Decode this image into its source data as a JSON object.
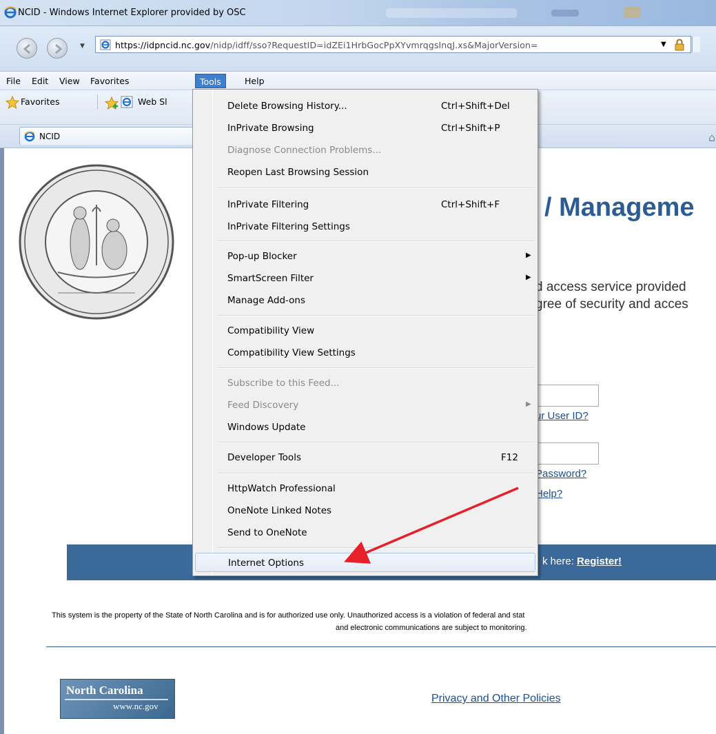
{
  "window": {
    "title": "NCID - Windows Internet Explorer provided by OSC",
    "url_host": "https://idpncid.nc.gov",
    "url_path": "/nidp/idff/sso?RequestID=idZEi1HrbGocPpXYvmrqgsInqJ.xs&MajorVersion="
  },
  "menubar": {
    "file": "File",
    "edit": "Edit",
    "view": "View",
    "favorites": "Favorites",
    "tools": "Tools",
    "help": "Help"
  },
  "favbar": {
    "favorites_label": "Favorites",
    "web_slice_label": "Web Sl"
  },
  "tab": {
    "label": "NCID"
  },
  "tools_menu": {
    "items": [
      {
        "label": "Delete Browsing History...",
        "shortcut": "Ctrl+Shift+Del"
      },
      {
        "label": "InPrivate Browsing",
        "shortcut": "Ctrl+Shift+P"
      },
      {
        "label": "Diagnose Connection Problems...",
        "disabled": true
      },
      {
        "label": "Reopen Last Browsing Session"
      },
      {
        "label": "InPrivate Filtering",
        "shortcut": "Ctrl+Shift+F"
      },
      {
        "label": "InPrivate Filtering Settings"
      },
      {
        "label": "Pop-up Blocker",
        "submenu": true
      },
      {
        "label": "SmartScreen Filter",
        "submenu": true
      },
      {
        "label": "Manage Add-ons"
      },
      {
        "label": "Compatibility View"
      },
      {
        "label": "Compatibility View Settings"
      },
      {
        "label": "Subscribe to this Feed...",
        "disabled": true
      },
      {
        "label": "Feed Discovery",
        "disabled": true,
        "submenu": true
      },
      {
        "label": "Windows Update"
      },
      {
        "label": "Developer Tools",
        "shortcut": "F12"
      },
      {
        "label": "HttpWatch Professional"
      },
      {
        "label": "OneNote Linked Notes"
      },
      {
        "label": "Send to OneNote"
      },
      {
        "label": "Internet Options",
        "highlighted": true
      }
    ],
    "submenu_glyph": "▶"
  },
  "page": {
    "heading_visible": "/ Manageme",
    "intro_line1": "d access service provided",
    "intro_line2": "gree of security and acces",
    "forgot_userid": "ur User ID?",
    "forgot_password": "Password?",
    "need_help": "Help?",
    "register_prefix": "k here: ",
    "register_link": "Register!",
    "legal_line1": "This system is the property of the State of North Carolina and is for authorized use only. Unauthorized access is a violation of federal and stat",
    "legal_line2": "and electronic communications are subject to monitoring.",
    "nc_logo_line1": "North Carolina",
    "nc_logo_line2": "www.nc.gov",
    "privacy_link": "Privacy and Other Policies"
  },
  "colors": {
    "heading": "#2b5d94",
    "banner": "#3b6a9a",
    "link": "#1b4f8f",
    "annotation_arrow": "#e8202a",
    "menu_active": "#3f7fcf"
  }
}
